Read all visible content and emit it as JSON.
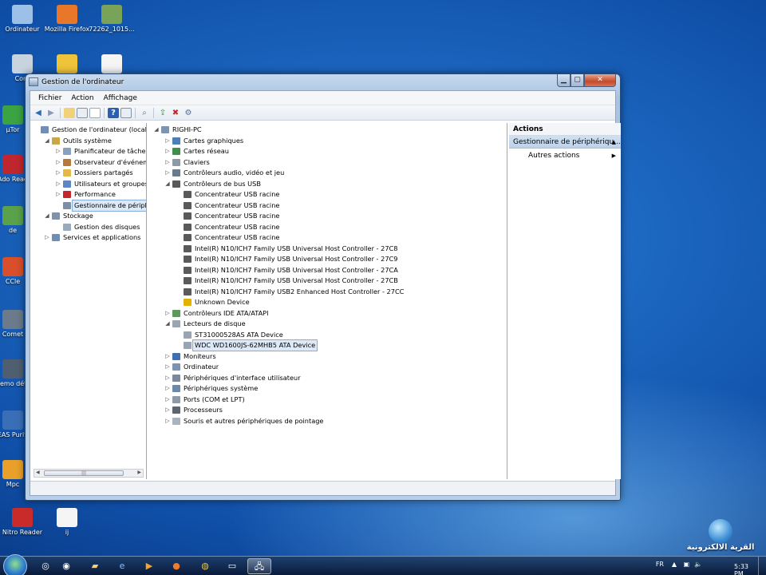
{
  "desktop_icons": [
    {
      "label": "Ordinateur",
      "icon": "computer-icon"
    },
    {
      "label": "Mozilla Firefox",
      "icon": "firefox-icon"
    },
    {
      "label": "72262_1015...",
      "icon": "image-file-icon"
    },
    {
      "label": "Corb",
      "icon": "recycle-bin-icon"
    },
    {
      "label": "",
      "icon": "shortcut-icon"
    },
    {
      "label": "",
      "icon": "document-icon"
    },
    {
      "label": "µTor",
      "icon": "utorrent-icon"
    },
    {
      "label": "Ado Read",
      "icon": "acrobat-icon"
    },
    {
      "label": "de",
      "icon": "app-icon"
    },
    {
      "label": "CCle",
      "icon": "ccleaner-icon"
    },
    {
      "label": "Comet",
      "icon": "app-icon"
    },
    {
      "label": "Demo déte",
      "icon": "app-icon"
    },
    {
      "label": "EAS Purifi",
      "icon": "app-icon"
    },
    {
      "label": "Mpc",
      "icon": "app-icon"
    },
    {
      "label": "Nitro Reader",
      "icon": "nitro-icon"
    },
    {
      "label": "ij",
      "icon": "document-icon"
    }
  ],
  "window": {
    "title": "Gestion de l'ordinateur",
    "menu": [
      "Fichier",
      "Action",
      "Affichage",
      "?"
    ]
  },
  "left_tree": [
    {
      "label": "Gestion de l'ordinateur (local)",
      "level": 0,
      "toggle": "",
      "icon": "computer-mgmt-icon"
    },
    {
      "label": "Outils système",
      "level": 1,
      "toggle": "◢",
      "icon": "tools-icon"
    },
    {
      "label": "Planificateur de tâches",
      "level": 2,
      "toggle": "▷",
      "icon": "clock-icon"
    },
    {
      "label": "Observateur d'événeme",
      "level": 2,
      "toggle": "▷",
      "icon": "event-viewer-icon"
    },
    {
      "label": "Dossiers partagés",
      "level": 2,
      "toggle": "▷",
      "icon": "shared-folder-icon"
    },
    {
      "label": "Utilisateurs et groupes l",
      "level": 2,
      "toggle": "▷",
      "icon": "users-icon"
    },
    {
      "label": "Performance",
      "level": 2,
      "toggle": "▷",
      "icon": "performance-icon"
    },
    {
      "label": "Gestionnaire de périphé",
      "level": 2,
      "toggle": "",
      "icon": "device-manager-icon",
      "selected": true
    },
    {
      "label": "Stockage",
      "level": 1,
      "toggle": "◢",
      "icon": "storage-icon"
    },
    {
      "label": "Gestion des disques",
      "level": 2,
      "toggle": "",
      "icon": "disk-icon"
    },
    {
      "label": "Services et applications",
      "level": 1,
      "toggle": "▷",
      "icon": "services-icon"
    }
  ],
  "device_tree": [
    {
      "label": "RIGHI-PC",
      "level": 0,
      "toggle": "◢",
      "icon": "computer-icon"
    },
    {
      "label": "Cartes graphiques",
      "level": 1,
      "toggle": "▷",
      "icon": "display-adapter-icon"
    },
    {
      "label": "Cartes réseau",
      "level": 1,
      "toggle": "▷",
      "icon": "network-adapter-icon"
    },
    {
      "label": "Claviers",
      "level": 1,
      "toggle": "▷",
      "icon": "keyboard-icon"
    },
    {
      "label": "Contrôleurs audio, vidéo et jeu",
      "level": 1,
      "toggle": "▷",
      "icon": "audio-icon"
    },
    {
      "label": "Contrôleurs de bus USB",
      "level": 1,
      "toggle": "◢",
      "icon": "usb-icon"
    },
    {
      "label": "Concentrateur USB racine",
      "level": 2,
      "toggle": "",
      "icon": "usb-icon"
    },
    {
      "label": "Concentrateur USB racine",
      "level": 2,
      "toggle": "",
      "icon": "usb-icon"
    },
    {
      "label": "Concentrateur USB racine",
      "level": 2,
      "toggle": "",
      "icon": "usb-icon"
    },
    {
      "label": "Concentrateur USB racine",
      "level": 2,
      "toggle": "",
      "icon": "usb-icon"
    },
    {
      "label": "Concentrateur USB racine",
      "level": 2,
      "toggle": "",
      "icon": "usb-icon"
    },
    {
      "label": "Intel(R) N10/ICH7 Family USB Universal Host Controller - 27C8",
      "level": 2,
      "toggle": "",
      "icon": "usb-icon"
    },
    {
      "label": "Intel(R) N10/ICH7 Family USB Universal Host Controller - 27C9",
      "level": 2,
      "toggle": "",
      "icon": "usb-icon"
    },
    {
      "label": "Intel(R) N10/ICH7 Family USB Universal Host Controller - 27CA",
      "level": 2,
      "toggle": "",
      "icon": "usb-icon"
    },
    {
      "label": "Intel(R) N10/ICH7 Family USB Universal Host Controller - 27CB",
      "level": 2,
      "toggle": "",
      "icon": "usb-icon"
    },
    {
      "label": "Intel(R) N10/ICH7 Family USB2 Enhanced Host Controller - 27CC",
      "level": 2,
      "toggle": "",
      "icon": "usb-icon"
    },
    {
      "label": "Unknown Device",
      "level": 2,
      "toggle": "",
      "icon": "warning-device-icon"
    },
    {
      "label": "Contrôleurs IDE ATA/ATAPI",
      "level": 1,
      "toggle": "▷",
      "icon": "ide-icon"
    },
    {
      "label": "Lecteurs de disque",
      "level": 1,
      "toggle": "◢",
      "icon": "disk-drive-icon"
    },
    {
      "label": "ST31000528AS ATA Device",
      "level": 2,
      "toggle": "",
      "icon": "disk-drive-icon"
    },
    {
      "label": "WDC WD1600JS-62MHB5 ATA Device",
      "level": 2,
      "toggle": "",
      "icon": "disk-drive-icon",
      "selected": true
    },
    {
      "label": "Moniteurs",
      "level": 1,
      "toggle": "▷",
      "icon": "monitor-icon"
    },
    {
      "label": "Ordinateur",
      "level": 1,
      "toggle": "▷",
      "icon": "computer-icon"
    },
    {
      "label": "Périphériques d'interface utilisateur",
      "level": 1,
      "toggle": "▷",
      "icon": "hid-icon"
    },
    {
      "label": "Périphériques système",
      "level": 1,
      "toggle": "▷",
      "icon": "system-device-icon"
    },
    {
      "label": "Ports (COM et LPT)",
      "level": 1,
      "toggle": "▷",
      "icon": "port-icon"
    },
    {
      "label": "Processeurs",
      "level": 1,
      "toggle": "▷",
      "icon": "processor-icon"
    },
    {
      "label": "Souris et autres périphériques de pointage",
      "level": 1,
      "toggle": "▷",
      "icon": "mouse-icon"
    }
  ],
  "actions": {
    "header": "Actions",
    "section": "Gestionnaire de périphériqu...",
    "item": "Autres actions"
  },
  "taskbar": {
    "lang": "FR",
    "time": "5:33 PM"
  },
  "watermark_text": "القرية الالكترونية",
  "colors": {
    "selection": "#dde9f7",
    "selection_border": "#84acdd",
    "titlebar": "#b9cfe8"
  }
}
